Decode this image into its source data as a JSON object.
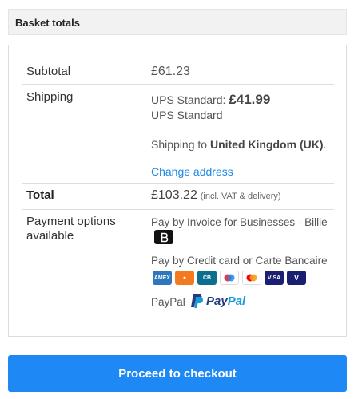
{
  "header": {
    "title": "Basket totals"
  },
  "subtotal": {
    "label": "Subtotal",
    "value": "£61.23"
  },
  "shipping": {
    "label": "Shipping",
    "method_prefix": "UPS Standard:",
    "method_price": "£41.99",
    "method_name": "UPS Standard",
    "ship_to_prefix": "Shipping to",
    "ship_to_country": "United Kingdom (UK)",
    "ship_to_suffix": ".",
    "change_address": "Change address"
  },
  "total": {
    "label": "Total",
    "value": "£103.22",
    "note": "(incl. VAT & delivery)"
  },
  "payment": {
    "label": "Payment options available",
    "methods": [
      {
        "name": "Pay by Invoice for Businesses - Billie"
      },
      {
        "name": "Pay by Credit card or Carte Bancaire"
      },
      {
        "name": "PayPal"
      }
    ],
    "card_icons": [
      "amex-icon",
      "discover-icon",
      "cartes-bancaires-icon",
      "maestro-icon",
      "mastercard-icon",
      "visa-icon",
      "v-pay-icon"
    ],
    "paypal_logo": "PayPal"
  },
  "checkout": {
    "label": "Proceed to checkout"
  },
  "colors": {
    "accent": "#1e88f5",
    "link": "#1e88e5"
  }
}
